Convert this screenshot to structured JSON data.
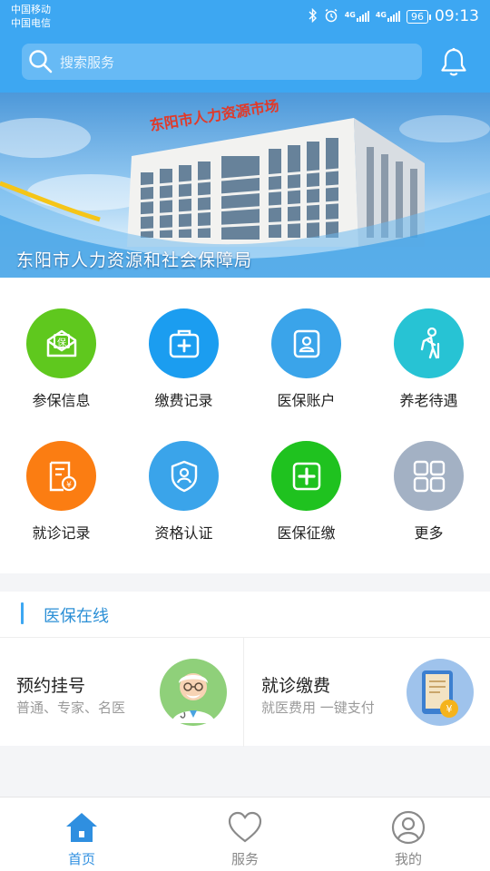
{
  "status_bar": {
    "carrier1": "中国移动",
    "carrier2": "中国电信",
    "net1": "4G",
    "net2": "4G",
    "battery": "96",
    "time": "09:13"
  },
  "search": {
    "placeholder": "搜索服务"
  },
  "banner": {
    "title": "东阳市人力资源和社会保障局",
    "building_sign": "东阳市人力资源市场"
  },
  "services": [
    {
      "label": "参保信息",
      "icon": "insurance-envelope-icon",
      "color": "#5fc81e"
    },
    {
      "label": "缴费记录",
      "icon": "medical-case-icon",
      "color": "#1b9df0"
    },
    {
      "label": "医保账户",
      "icon": "account-card-icon",
      "color": "#3aa4ea"
    },
    {
      "label": "养老待遇",
      "icon": "elderly-icon",
      "color": "#27c3d4"
    },
    {
      "label": "就诊记录",
      "icon": "receipt-icon",
      "color": "#fb7d12"
    },
    {
      "label": "资格认证",
      "icon": "shield-person-icon",
      "color": "#3aa4ea"
    },
    {
      "label": "医保征缴",
      "icon": "plus-box-icon",
      "color": "#1fc21f"
    },
    {
      "label": "更多",
      "icon": "grid-more-icon",
      "color": "#a3b1c4"
    }
  ],
  "section": {
    "title": "医保在线"
  },
  "cards": [
    {
      "title": "预约挂号",
      "subtitle": "普通、专家、名医",
      "icon": "doctor-avatar-icon"
    },
    {
      "title": "就诊缴费",
      "subtitle": "就医费用 一键支付",
      "icon": "payment-bill-icon"
    }
  ],
  "tabs": [
    {
      "label": "首页",
      "icon": "home-icon",
      "active": true
    },
    {
      "label": "服务",
      "icon": "heart-icon",
      "active": false
    },
    {
      "label": "我的",
      "icon": "user-icon",
      "active": false
    }
  ],
  "colors": {
    "primary": "#3da7f2",
    "active_tab": "#2f8fe0"
  }
}
